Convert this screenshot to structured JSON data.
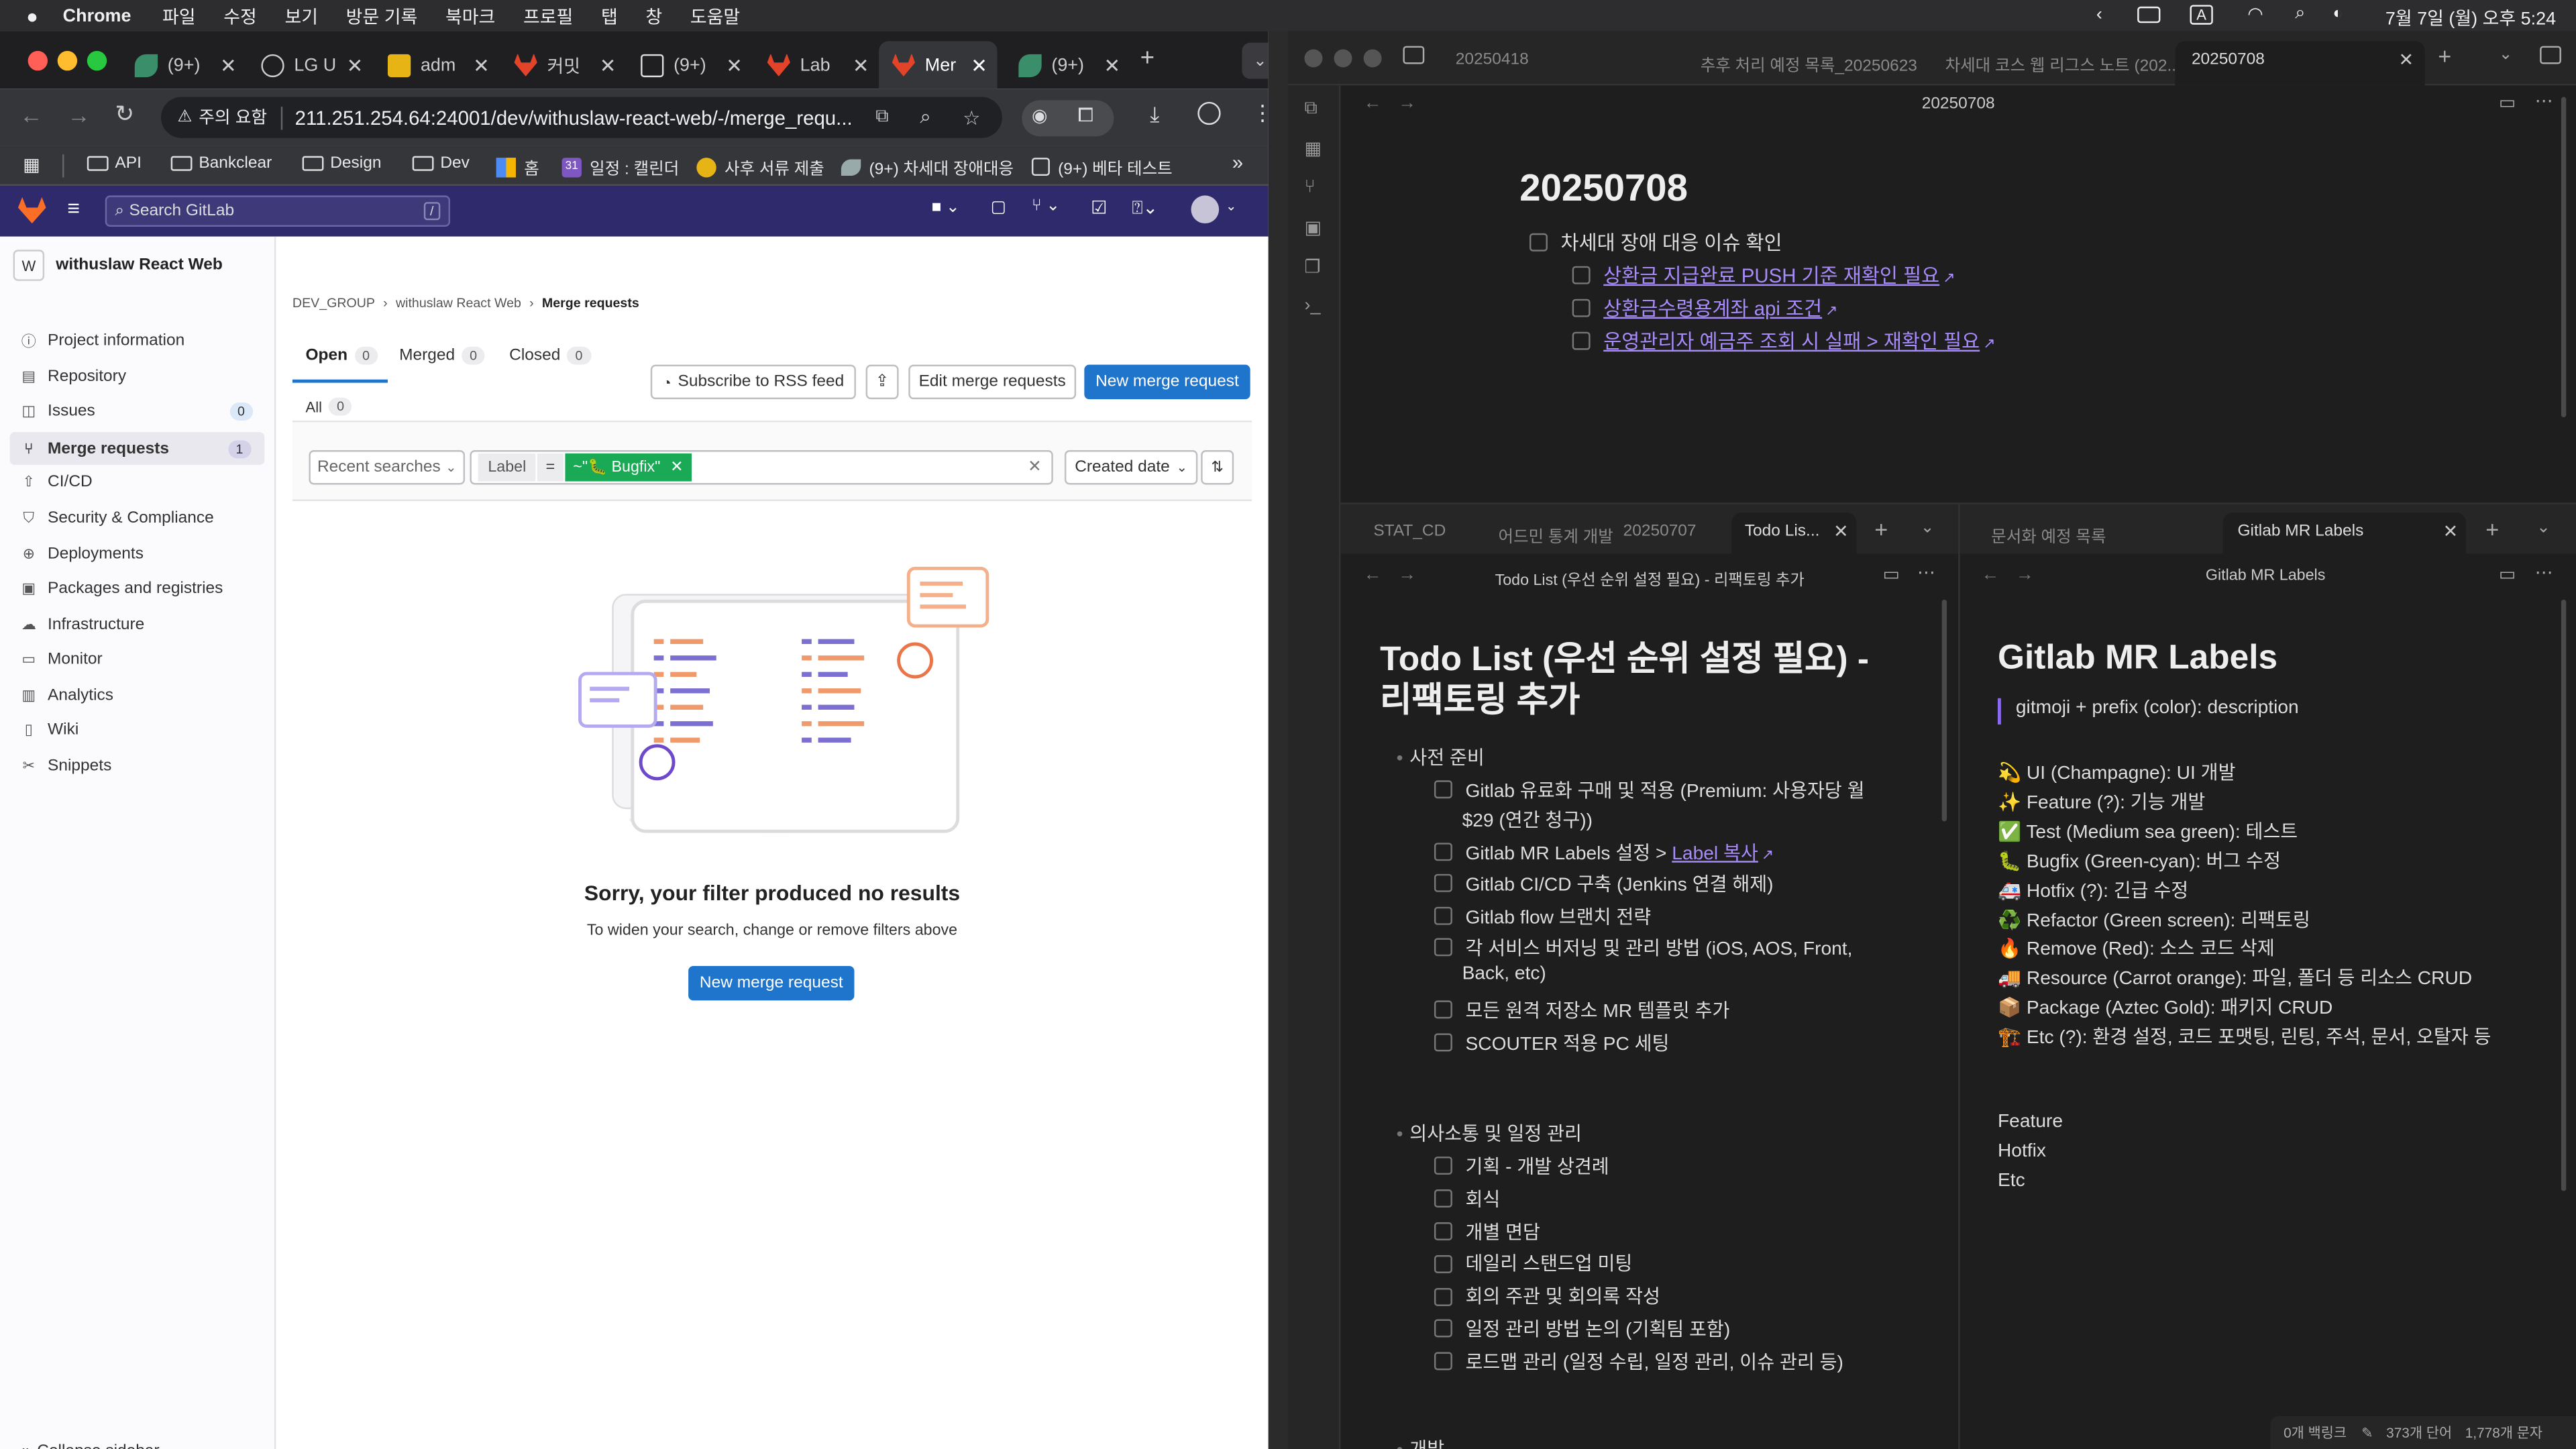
{
  "menubar": {
    "app": "Chrome",
    "items": [
      "파일",
      "수정",
      "보기",
      "방문 기록",
      "북마크",
      "프로필",
      "탭",
      "창",
      "도움말"
    ],
    "clock": "7월 7일 (월) 오후 5:24",
    "input": "A"
  },
  "browser": {
    "tabs": [
      "(9+)",
      "LG U",
      "adm",
      "커밋",
      "(9+)",
      "Lab",
      "Mer",
      "(9+)"
    ],
    "url_warning": "주의 요함",
    "url": "211.251.254.64:24001/dev/withuslaw-react-web/-/merge_requ...",
    "bookmarks": [
      "API",
      "Bankclear",
      "Design",
      "Dev",
      "홈",
      "일정 : 캘린더",
      "사후 서류 제출",
      "(9+) 차세대 장애대응",
      "(9+) 베타 테스트"
    ],
    "bookmark_cal_num": "31"
  },
  "gitlab": {
    "search_placeholder": "Search GitLab",
    "search_shortcut": "/",
    "project": {
      "letter": "W",
      "name": "withuslaw React Web"
    },
    "sidebar": [
      {
        "label": "Project information",
        "icon": "info-icon"
      },
      {
        "label": "Repository",
        "icon": "book-icon"
      },
      {
        "label": "Issues",
        "icon": "issues-icon",
        "count": "0"
      },
      {
        "label": "Merge requests",
        "icon": "merge-request-icon",
        "count": "1"
      },
      {
        "label": "CI/CD",
        "icon": "rocket-icon"
      },
      {
        "label": "Security & Compliance",
        "icon": "shield-icon"
      },
      {
        "label": "Deployments",
        "icon": "deployments-icon"
      },
      {
        "label": "Packages and registries",
        "icon": "package-icon"
      },
      {
        "label": "Infrastructure",
        "icon": "cloud-icon"
      },
      {
        "label": "Monitor",
        "icon": "monitor-icon"
      },
      {
        "label": "Analytics",
        "icon": "chart-icon"
      },
      {
        "label": "Wiki",
        "icon": "wiki-icon"
      },
      {
        "label": "Snippets",
        "icon": "snippet-icon"
      }
    ],
    "collapse": "Collapse sidebar",
    "breadcrumb": [
      "DEV_GROUP",
      "withuslaw React Web",
      "Merge requests"
    ],
    "tabs": [
      {
        "label": "Open",
        "count": "0"
      },
      {
        "label": "Merged",
        "count": "0"
      },
      {
        "label": "Closed",
        "count": "0"
      }
    ],
    "rss": "Subscribe to RSS feed",
    "edit_mr": "Edit merge requests",
    "new_mr": "New merge request",
    "all_label": "All",
    "all_count": "0",
    "recent": "Recent searches",
    "filter_key": "Label",
    "filter_op": "=",
    "filter_value": "~\"🐛 Bugfix\"",
    "sort": "Created date",
    "empty_title": "Sorry, your filter produced no results",
    "empty_sub": "To widen your search, change or remove filters above",
    "empty_btn": "New merge request",
    "colors": {
      "header": "#2f2a6b",
      "primary": "#1f75cb",
      "label": "#1aaa55"
    }
  },
  "obsidian": {
    "top_tabs": [
      "20250418",
      "추후 처리 예정 목록_20250623",
      "차세대 코스 웹 리그스 노트 (202...",
      "20250708"
    ],
    "top_title": "20250708",
    "top_heading": "20250708",
    "top_task": "차세대 장애 대응 이슈 확인",
    "top_links": [
      "상환금 지급완료 PUSH 기준 재확인 필요",
      "상환금수령용계좌 api 조건",
      "운영관리자 예금주 조회 시 실패 > 재확인 필요"
    ],
    "left_tabs": [
      "STAT_CD",
      "어드민 통계 개발",
      "20250707",
      "Todo Lis..."
    ],
    "left_title": "Todo List (우선 순위 설정 필요) - 리팩토링 추가",
    "left_heading": "Todo List (우선 순위 설정 필요) - 리팩토링 추가",
    "sec1": "사전 준비",
    "sec1_items": [
      "Gitlab 유료화 구매 및 적용 (Premium: 사용자당 월",
      "$29 (연간 청구))",
      "Gitlab MR Labels 설정 > ",
      "Label 복사",
      "Gitlab CI/CD 구축 (Jenkins 연결 해제)",
      "Gitlab flow 브랜치 전략",
      "각 서비스 버저닝 및 관리 방법 (iOS, AOS, Front,",
      "Back, etc)",
      "모든 원격 저장소 MR 템플릿 추가",
      "SCOUTER 적용 PC 세팅"
    ],
    "sec2": "의사소통 및 일정 관리",
    "sec2_items": [
      "기획 - 개발 상견례",
      "회식",
      "개별 면담",
      "데일리 스탠드업 미팅",
      "회의 주관 및 회의록 작성",
      "일정 관리 방법 논의 (기획팀 포함)",
      "로드맵 관리 (일정 수립, 일정 관리, 이슈 관리 등)"
    ],
    "sec3": "개발",
    "right_tabs": [
      "문서화 예정 목록",
      "Gitlab MR Labels"
    ],
    "right_title": "Gitlab MR Labels",
    "right_heading": "Gitlab MR Labels",
    "quote": "gitmoji + prefix (color): description",
    "labels": [
      "💫 UI (Champagne): UI 개발",
      "✨ Feature (?): 기능 개발",
      "✅ Test (Medium sea green): 테스트",
      "🐛 Bugfix (Green-cyan): 버그 수정",
      "🚑 Hotfix (?): 긴급 수정",
      "♻️ Refactor (Green screen): 리팩토링",
      "🔥 Remove (Red): 소스 코드 삭제",
      "🚚 Resource (Carrot orange): 파일, 폴더 등 리소스 CRUD",
      "📦 Package (Aztec Gold): 패키지 CRUD",
      "🏗️ Etc (?): 환경 설정, 코드 포맷팅, 린팅, 주석, 문서, 오탈자 등"
    ],
    "extra": [
      "Feature",
      "Hotfix",
      "Etc"
    ],
    "status": [
      "0개 백링크",
      "373개 단어",
      "1,778개 문자"
    ]
  }
}
